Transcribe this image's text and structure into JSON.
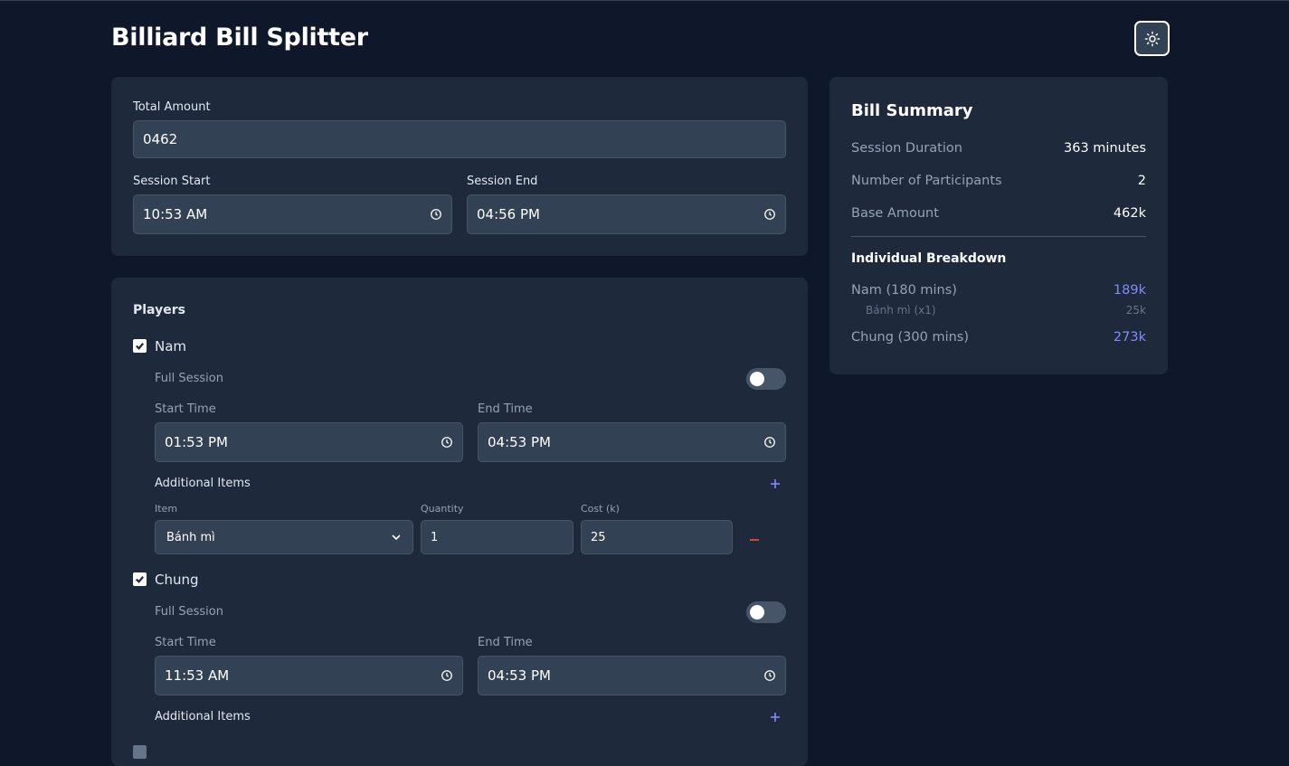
{
  "app": {
    "title": "Billiard Bill Splitter",
    "theme_icon": "sun-icon"
  },
  "session": {
    "total_label": "Total Amount",
    "total_value": "0462",
    "start_label": "Session Start",
    "start_value": "10:53 AM",
    "end_label": "Session End",
    "end_value": "04:56 PM"
  },
  "players": {
    "title": "Players",
    "full_session_label": "Full Session",
    "start_label": "Start Time",
    "end_label": "End Time",
    "items_label": "Additional Items",
    "col_item": "Item",
    "col_qty": "Quantity",
    "col_cost": "Cost (k)",
    "list": [
      {
        "name": "Nam",
        "checked": true,
        "full_session": false,
        "start": "01:53 PM",
        "end": "04:53 PM",
        "items": [
          {
            "item": "Bánh mì",
            "qty": "1",
            "cost": "25"
          }
        ]
      },
      {
        "name": "Chung",
        "checked": true,
        "full_session": false,
        "start": "11:53 AM",
        "end": "04:53 PM",
        "items": []
      }
    ]
  },
  "summary": {
    "title": "Bill Summary",
    "duration_label": "Session Duration",
    "duration_value": "363 minutes",
    "participants_label": "Number of Participants",
    "participants_value": "2",
    "base_label": "Base Amount",
    "base_value": "462k",
    "breakdown_title": "Individual Breakdown",
    "breakdown": [
      {
        "label": "Nam (180 mins)",
        "value": "189k",
        "items": [
          {
            "label": "Bánh mì (x1)",
            "value": "25k"
          }
        ]
      },
      {
        "label": "Chung (300 mins)",
        "value": "273k",
        "items": []
      }
    ]
  },
  "colors": {
    "background": "#0f172a",
    "card": "#1e293b",
    "input": "#334155",
    "accent": "#818cf8",
    "danger": "#ef4444"
  }
}
